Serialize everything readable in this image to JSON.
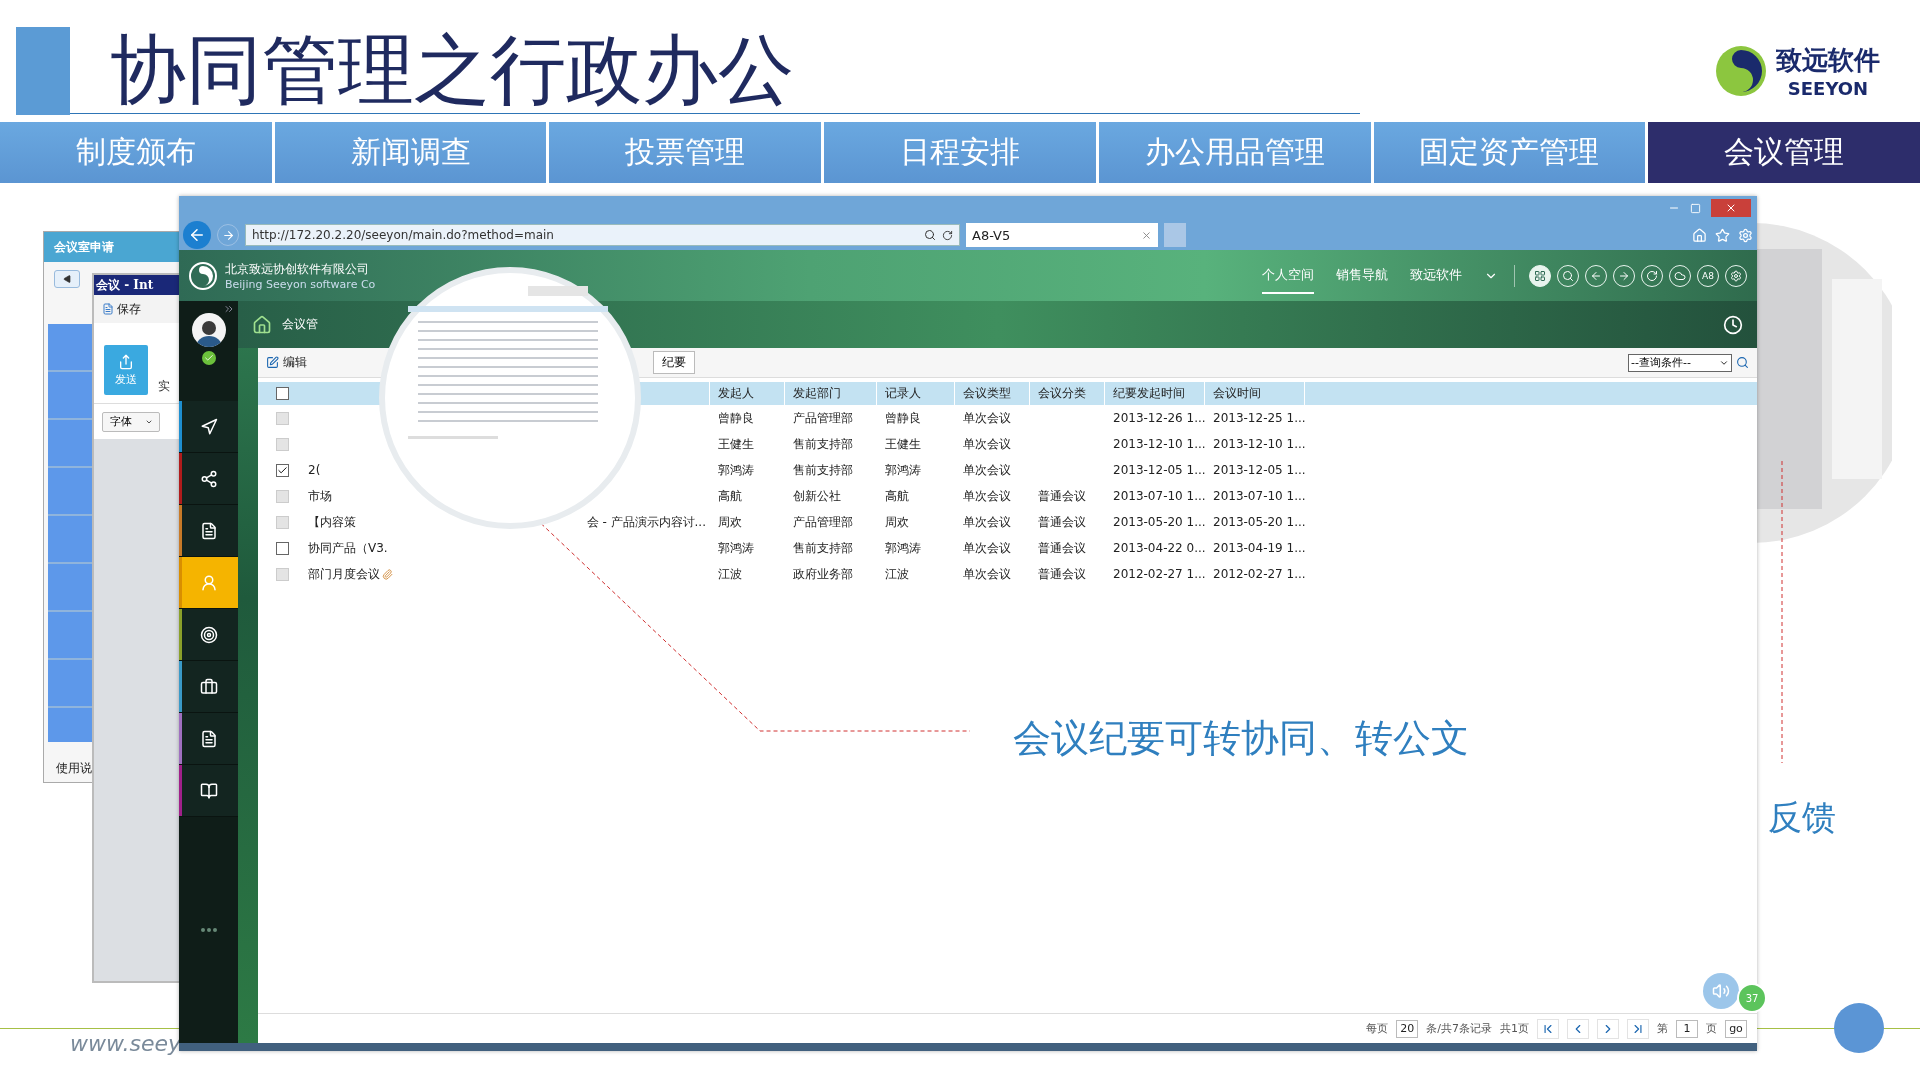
{
  "slide": {
    "title": "协同管理之行政办公",
    "logo_name": "致远软件",
    "logo_latin": "SEEYON",
    "tabs": [
      {
        "label": "制度颁布",
        "selected": false
      },
      {
        "label": "新闻调查",
        "selected": false
      },
      {
        "label": "投票管理",
        "selected": false
      },
      {
        "label": "日程安排",
        "selected": false
      },
      {
        "label": "办公用品管理",
        "selected": false
      },
      {
        "label": "固定资产管理",
        "selected": false
      },
      {
        "label": "会议管理",
        "selected": true
      }
    ],
    "callout": "会议纪要可转协同、转公文",
    "side_text": "反馈",
    "footer_url": "www.seey"
  },
  "back_window": {
    "title": "会议室申请",
    "inner_title": "会议 - Int",
    "save": "保存",
    "send": "发送",
    "partial_label": "实",
    "font_menu": "字体",
    "help": "使用说"
  },
  "browser": {
    "url": "http://172.20.2.20/seeyon/main.do?method=main",
    "tab_title": "A8-V5"
  },
  "app": {
    "company": "北京致远协创软件有限公司",
    "company_en": "Beijing Seeyon software Co",
    "nav": [
      {
        "label": "个人空间",
        "selected": true
      },
      {
        "label": "销售导航",
        "selected": false
      },
      {
        "label": "致远软件",
        "selected": false
      }
    ],
    "a8": "A8",
    "breadcrumb": "会议管",
    "sidebar": [
      {
        "kind": "navigate",
        "color": "#1e8fd0",
        "selected": false
      },
      {
        "kind": "share",
        "color": "#b01c1c",
        "selected": false
      },
      {
        "kind": "document",
        "color": "#c87a28",
        "selected": false
      },
      {
        "kind": "meeting",
        "color": "#d98e00",
        "selected": true
      },
      {
        "kind": "target",
        "color": "#8aa02a",
        "selected": false
      },
      {
        "kind": "briefcase",
        "color": "#3a9ac8",
        "selected": false
      },
      {
        "kind": "document",
        "color": "#a070c0",
        "selected": false
      },
      {
        "kind": "book",
        "color": "#a0208a",
        "selected": false
      }
    ],
    "select_all_checked": false,
    "edit": "编辑",
    "minutes": "纪要",
    "query": "--查询条件--",
    "columns": [
      "发起人",
      "发起部门",
      "记录人",
      "会议类型",
      "会议分类",
      "纪要发起时间",
      "会议时间"
    ],
    "rows": [
      {
        "checked": false,
        "disabled": true,
        "cells": [
          "曾静良",
          "产品管理部",
          "曾静良",
          "单次会议",
          "",
          "2013-12-26 1...",
          "2013-12-25 1..."
        ]
      },
      {
        "checked": false,
        "disabled": true,
        "cells": [
          "王健生",
          "售前支持部",
          "王健生",
          "单次会议",
          "",
          "2013-12-10 1...",
          "2013-12-10 1..."
        ]
      },
      {
        "checked": true,
        "disabled": false,
        "title": "2(",
        "cells": [
          "郭鸿涛",
          "售前支持部",
          "郭鸿涛",
          "单次会议",
          "",
          "2013-12-05 1...",
          "2013-12-05 1..."
        ]
      },
      {
        "checked": false,
        "disabled": true,
        "title": "市场",
        "cells": [
          "高航",
          "创新公社",
          "高航",
          "单次会议",
          "普通会议",
          "2013-07-10 1...",
          "2013-07-10 1..."
        ]
      },
      {
        "checked": false,
        "disabled": true,
        "title": "【内容策",
        "title_tail": "会 - 产品演示内容讨...",
        "cells": [
          "周欢",
          "产品管理部",
          "周欢",
          "单次会议",
          "普通会议",
          "2013-05-20 1...",
          "2013-05-20 1..."
        ]
      },
      {
        "checked": false,
        "disabled": false,
        "title": "协同产品（V3.",
        "cells": [
          "郭鸿涛",
          "售前支持部",
          "郭鸿涛",
          "单次会议",
          "普通会议",
          "2013-04-22 0...",
          "2013-04-19 1..."
        ]
      },
      {
        "checked": false,
        "disabled": true,
        "title": "部门月度会议",
        "attachment": true,
        "cells": [
          "江波",
          "政府业务部",
          "江波",
          "单次会议",
          "普通会议",
          "2012-02-27 1...",
          "2012-02-27 1..."
        ]
      }
    ],
    "pager": {
      "per_page_label": "每页",
      "per_page": "20",
      "summary": "条/共7条记录",
      "pages": "共1页",
      "page_label": "第",
      "page": "1",
      "page_unit": "页",
      "go": "go"
    },
    "badge": "37"
  }
}
